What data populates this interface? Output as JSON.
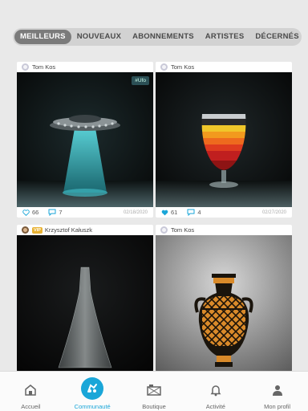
{
  "tabs": [
    {
      "label": "MEILLEURS",
      "active": true
    },
    {
      "label": "NOUVEAUX",
      "active": false
    },
    {
      "label": "ABONNEMENTS",
      "active": false
    },
    {
      "label": "ARTISTES",
      "active": false
    },
    {
      "label": "DÉCERNÉS",
      "active": false
    }
  ],
  "posts": [
    {
      "author": "Tom Kos",
      "tag": "#Ufo",
      "likes": "66",
      "comments": "7",
      "date": "02/18/2020",
      "liked": false,
      "artwork": "ufo-vase"
    },
    {
      "author": "Tom Kos",
      "tag": "",
      "likes": "61",
      "comments": "4",
      "date": "02/27/2020",
      "liked": true,
      "artwork": "striped-goblet"
    },
    {
      "author": "Krzysztof Kałuszk",
      "badge": "VIP",
      "artwork": "glass-bottle"
    },
    {
      "author": "Tom Kos",
      "artwork": "greek-amphora"
    }
  ],
  "nav": [
    {
      "label": "Accueil",
      "icon": "home-icon",
      "active": false
    },
    {
      "label": "Communauté",
      "icon": "community-icon",
      "active": true
    },
    {
      "label": "Boutique",
      "icon": "shop-icon",
      "active": false
    },
    {
      "label": "Activité",
      "icon": "bell-icon",
      "active": false
    },
    {
      "label": "Mon profil",
      "icon": "profile-icon",
      "active": false
    }
  ],
  "colors": {
    "accent": "#1aa6d8",
    "like": "#1aa6d8",
    "tab_active": "#7b7b7b"
  }
}
